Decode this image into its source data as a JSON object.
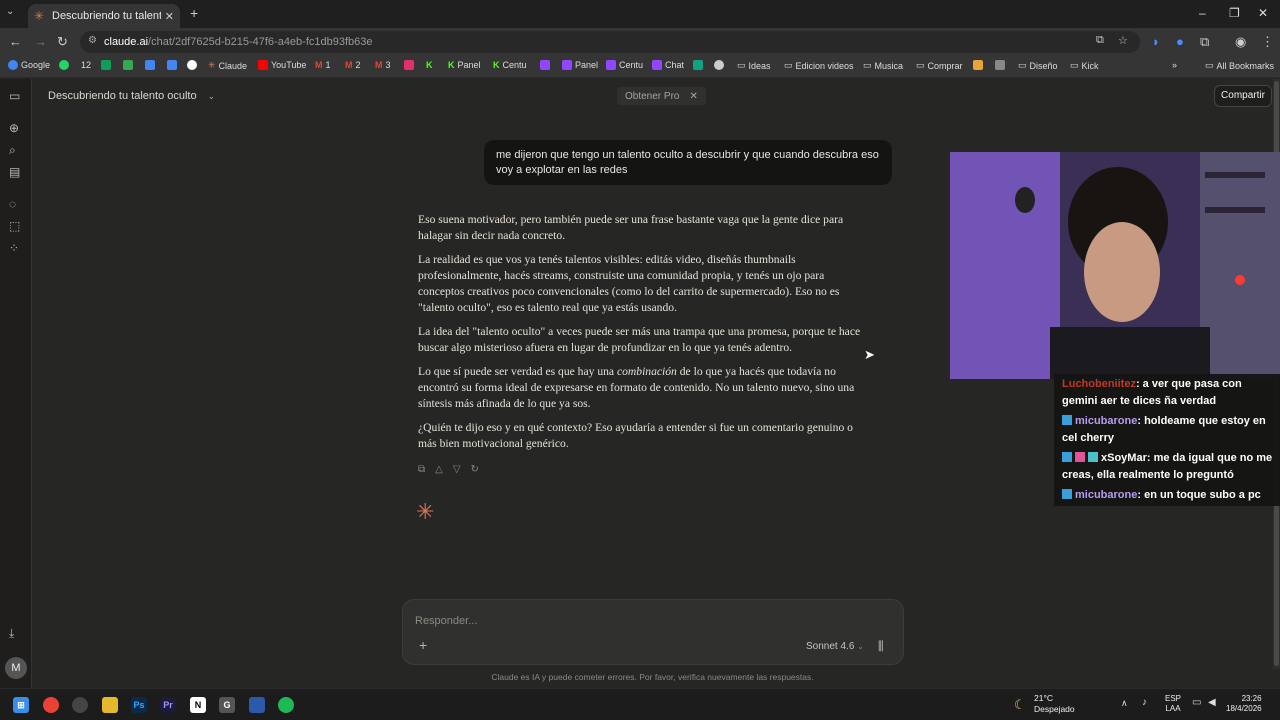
{
  "browser": {
    "tab_title": "Descubriendo tu talento oculto",
    "url_host": "claude.ai",
    "url_path": "/chat/2df7625d-b215-47f6-a4eb-fc1db93fb63e",
    "bookmarks": [
      {
        "label": "Google",
        "color": "#4285f4"
      },
      {
        "label": "12",
        "color": "#25d366"
      },
      {
        "label": "",
        "color": "#0f9d58"
      },
      {
        "label": "",
        "color": "#34a853"
      },
      {
        "label": "",
        "color": "#4285f4"
      },
      {
        "label": "",
        "color": "#4285f4"
      },
      {
        "label": "",
        "color": "#ffffff"
      },
      {
        "label": "Claude",
        "color": "#d97757"
      },
      {
        "label": "YouTube",
        "color": "#ff0000"
      },
      {
        "label": "1",
        "color": "#ea4335"
      },
      {
        "label": "2",
        "color": "#ea4335"
      },
      {
        "label": "3",
        "color": "#ea4335"
      },
      {
        "label": "",
        "color": "#e1306c"
      },
      {
        "label": "",
        "color": "#53fc18"
      },
      {
        "label": "Panel",
        "color": "#53fc18"
      },
      {
        "label": "Centu",
        "color": "#53fc18"
      },
      {
        "label": "",
        "color": "#9146ff"
      },
      {
        "label": "Panel",
        "color": "#9146ff"
      },
      {
        "label": "Centu",
        "color": "#9146ff"
      },
      {
        "label": "Chat",
        "color": "#9146ff"
      },
      {
        "label": "",
        "color": "#10a37f"
      },
      {
        "label": "",
        "color": "#cccccc"
      },
      {
        "label": "Ideas",
        "color": "folder"
      },
      {
        "label": "Edicion videos",
        "color": "folder"
      },
      {
        "label": "Musica",
        "color": "folder"
      },
      {
        "label": "Comprar",
        "color": "folder"
      },
      {
        "label": "",
        "color": "#e8a33a"
      },
      {
        "label": "",
        "color": "#888888"
      },
      {
        "label": "Diseño",
        "color": "folder"
      },
      {
        "label": "Kick",
        "color": "folder"
      }
    ],
    "all_bookmarks": "All Bookmarks"
  },
  "app": {
    "chat_title": "Descubriendo tu talento oculto",
    "pro_pill": "Obtener Pro",
    "share_label": "Compartir",
    "avatar_initial": "M",
    "user_message": "me dijeron que tengo un talento oculto a descubrir y que cuando descubra eso voy a explotar en las redes",
    "assistant_paragraphs": [
      "Eso suena motivador, pero también puede ser una frase bastante vaga que la gente dice para halagar sin decir nada concreto.",
      "La realidad es que vos ya tenés talentos visibles: editás video, diseñás thumbnails profesionalmente, hacés streams, construiste una comunidad propia, y tenés un ojo para conceptos creativos poco convencionales (como lo del carrito de supermercado). Eso no es \"talento oculto\", eso es talento real que ya estás usando.",
      "La idea del \"talento oculto\" a veces puede ser más una trampa que una promesa, porque te hace buscar algo misterioso afuera en lugar de profundizar en lo que ya tenés adentro.",
      "Lo que sí puede ser verdad es que hay una combinación de lo que ya hacés que todavía no encontró su forma ideal de expresarse en formato de contenido. No un talento nuevo, sino una síntesis más afinada de lo que ya sos.",
      "¿Quién te dijo eso y en qué contexto? Eso ayudaría a entender si fue un comentario genuino o más bien motivacional genérico."
    ],
    "composer_placeholder": "Responder...",
    "model": "Sonnet 4.6",
    "disclaimer": "Claude es IA y puede cometer errores. Por favor, verifica nuevamente las respuestas."
  },
  "stream_chat": [
    {
      "user": "Luchobeniitez",
      "user_color": "#c0392b",
      "text": ": a ver que pasa con gemini aer te dices ña verdad"
    },
    {
      "user": "micubarone",
      "user_color": "#b79cf0",
      "text": ": holdeame que estoy en cel cherry"
    },
    {
      "user": "xSoyMar",
      "user_color": "#ffffff",
      "text": ": me da igual que no me creas, ella realmente lo preguntó"
    },
    {
      "user": "micubarone",
      "user_color": "#b79cf0",
      "text": ": en un toque subo a pc"
    }
  ],
  "taskbar": {
    "temperature": "21°C",
    "weather": "Despejado",
    "lang1": "ESP",
    "lang2": "LAA",
    "time": "23:26",
    "date": "18/4/2026"
  }
}
